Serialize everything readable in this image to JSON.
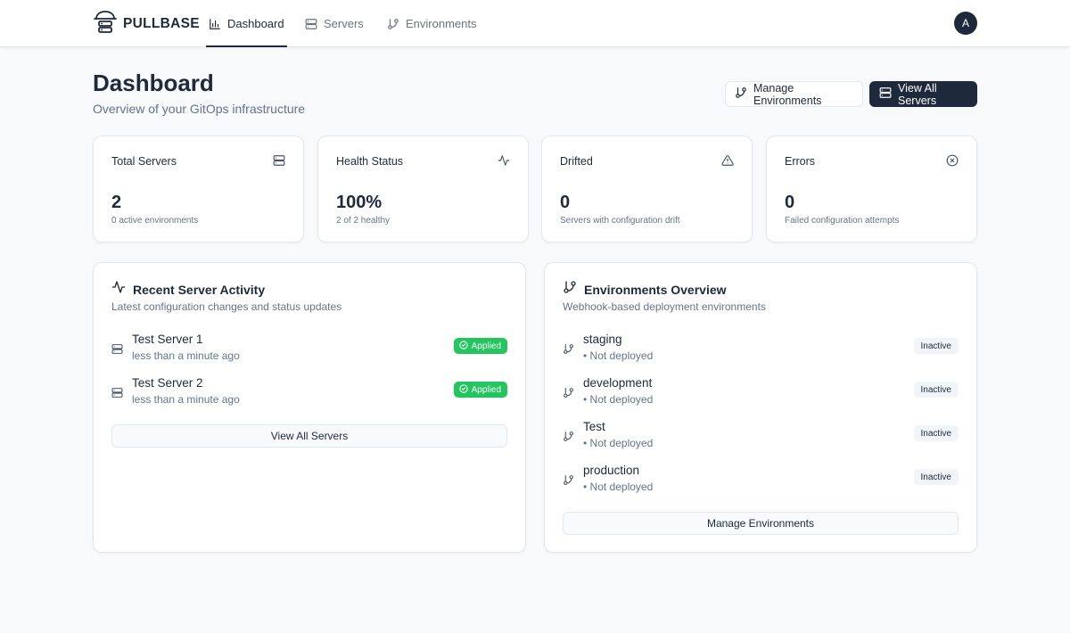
{
  "brand": {
    "name": "PULLBASE"
  },
  "nav": {
    "items": [
      {
        "label": "Dashboard",
        "icon": "bar-chart-icon",
        "active": true
      },
      {
        "label": "Servers",
        "icon": "server-icon",
        "active": false
      },
      {
        "label": "Environments",
        "icon": "git-branch-icon",
        "active": false
      }
    ],
    "avatar_initial": "A"
  },
  "header": {
    "title": "Dashboard",
    "subtitle": "Overview of your GitOps infrastructure",
    "manage_environments_label": "Manage Environments",
    "view_all_servers_label": "View All Servers"
  },
  "stats": [
    {
      "label": "Total Servers",
      "value": "2",
      "sub": "0 active environments",
      "icon": "server-icon"
    },
    {
      "label": "Health Status",
      "value": "100%",
      "sub": "2 of 2 healthy",
      "icon": "activity-icon"
    },
    {
      "label": "Drifted",
      "value": "0",
      "sub": "Servers with configuration drift",
      "icon": "warning-icon"
    },
    {
      "label": "Errors",
      "value": "0",
      "sub": "Failed configuration attempts",
      "icon": "x-circle-icon"
    }
  ],
  "activity": {
    "title": "Recent Server Activity",
    "subtitle": "Latest configuration changes and status updates",
    "items": [
      {
        "name": "Test Server 1",
        "time": "less than a minute ago",
        "status": "Applied"
      },
      {
        "name": "Test Server 2",
        "time": "less than a minute ago",
        "status": "Applied"
      }
    ],
    "button_label": "View All Servers"
  },
  "environments": {
    "title": "Environments Overview",
    "subtitle": "Webhook-based deployment environments",
    "items": [
      {
        "name": "staging",
        "meta": "• Not deployed",
        "status": "Inactive"
      },
      {
        "name": "development",
        "meta": "• Not deployed",
        "status": "Inactive"
      },
      {
        "name": "Test",
        "meta": "• Not deployed",
        "status": "Inactive"
      },
      {
        "name": "production",
        "meta": "• Not deployed",
        "status": "Inactive"
      }
    ],
    "button_label": "Manage Environments"
  },
  "colors": {
    "primary": "#1e293b",
    "applied": "#22c55e",
    "muted_text": "#64748b",
    "inactive_badge_bg": "#f1f5f9"
  }
}
